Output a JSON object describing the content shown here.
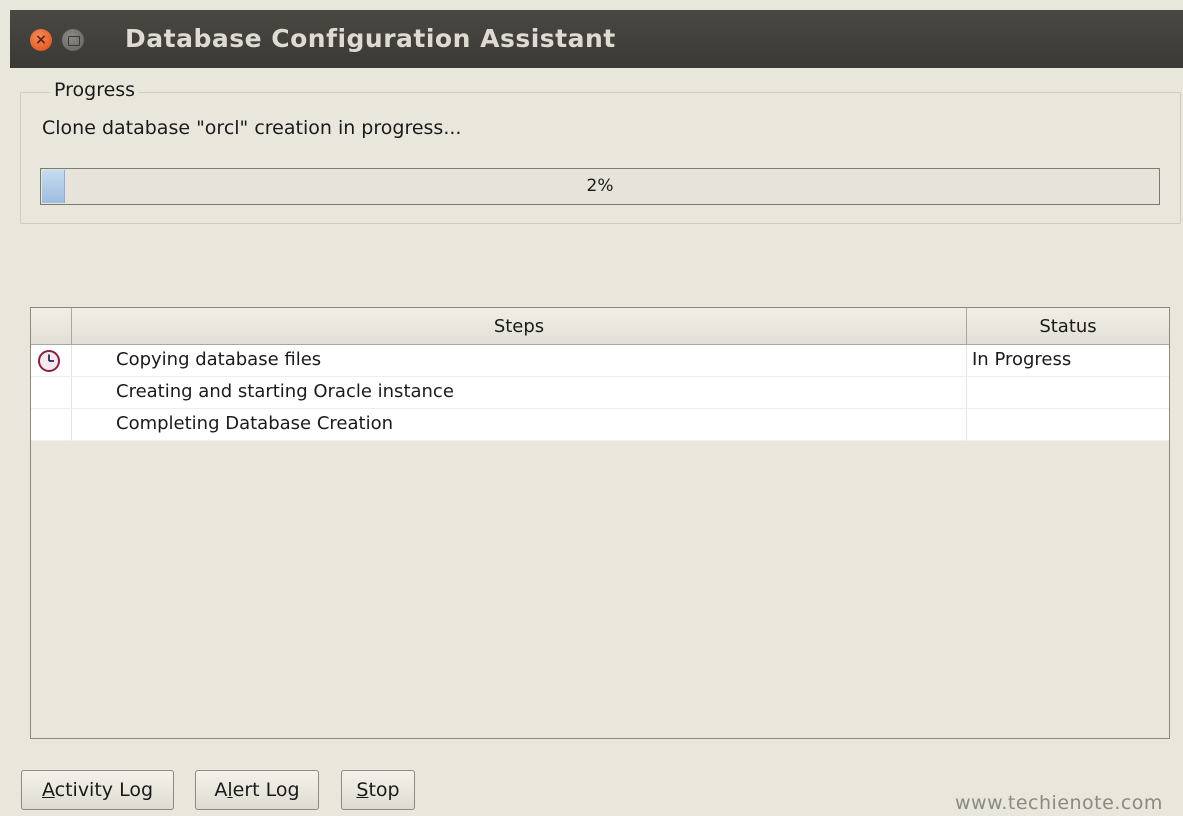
{
  "window": {
    "title": "Database Configuration Assistant",
    "close_glyph": "×"
  },
  "progress": {
    "group_label": "Progress",
    "message": "Clone database \"orcl\" creation in progress...",
    "percent_text": "2%",
    "percent_value": 0.02
  },
  "steps_table": {
    "columns": {
      "steps": "Steps",
      "status": "Status"
    },
    "rows": [
      {
        "icon": "clock-icon",
        "step": "Copying database files",
        "status": "In Progress"
      },
      {
        "icon": "",
        "step": "Creating and starting Oracle instance",
        "status": ""
      },
      {
        "icon": "",
        "step": "Completing Database Creation",
        "status": ""
      }
    ]
  },
  "buttons": {
    "activity_log": {
      "mnemonic": "A",
      "rest": "ctivity Log"
    },
    "alert_log": {
      "prefix": "A",
      "mnemonic": "l",
      "rest": "ert Log"
    },
    "stop": {
      "mnemonic": "S",
      "rest": "top"
    }
  },
  "watermark": "www.techienote.com",
  "colors": {
    "background": "#e9e7dc",
    "titlebar": "#3f3e3a",
    "close_button": "#df4a15",
    "progress_fill": "#9ebddf"
  }
}
